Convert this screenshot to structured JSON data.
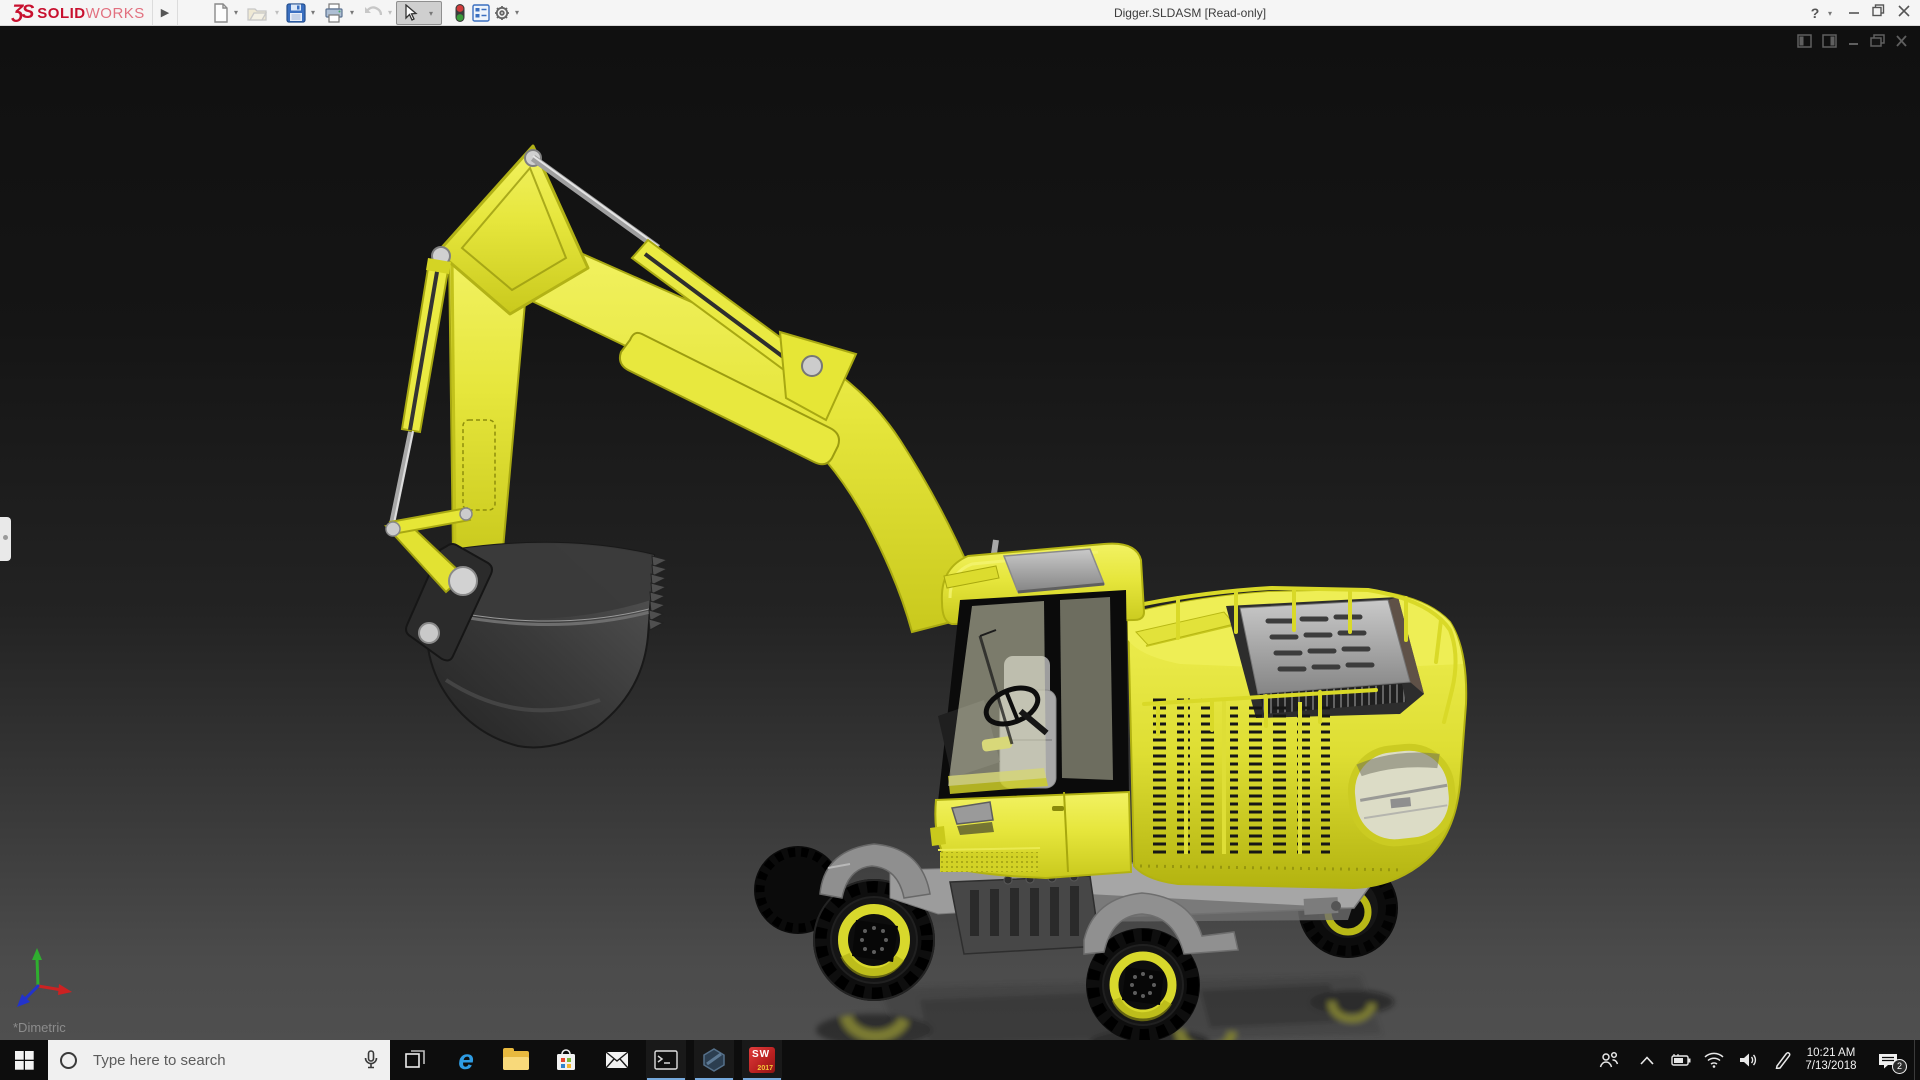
{
  "titlebar": {
    "logo": {
      "glyph": "ƷS",
      "bold": "SOLID",
      "light": "WORKS"
    },
    "flyout": "▶",
    "title": "Digger.SLDASM [Read-only]",
    "help_label": "?",
    "caret": "▾"
  },
  "viewport": {
    "view_label": "*Dimetric"
  },
  "taskbar": {
    "search_placeholder": "Type here to search",
    "edge_glyph": "e",
    "sw": {
      "label": "SW",
      "year": "2017"
    },
    "tray": {
      "time": "10:21 AM",
      "date": "7/13/2018",
      "notifications": "2"
    }
  }
}
